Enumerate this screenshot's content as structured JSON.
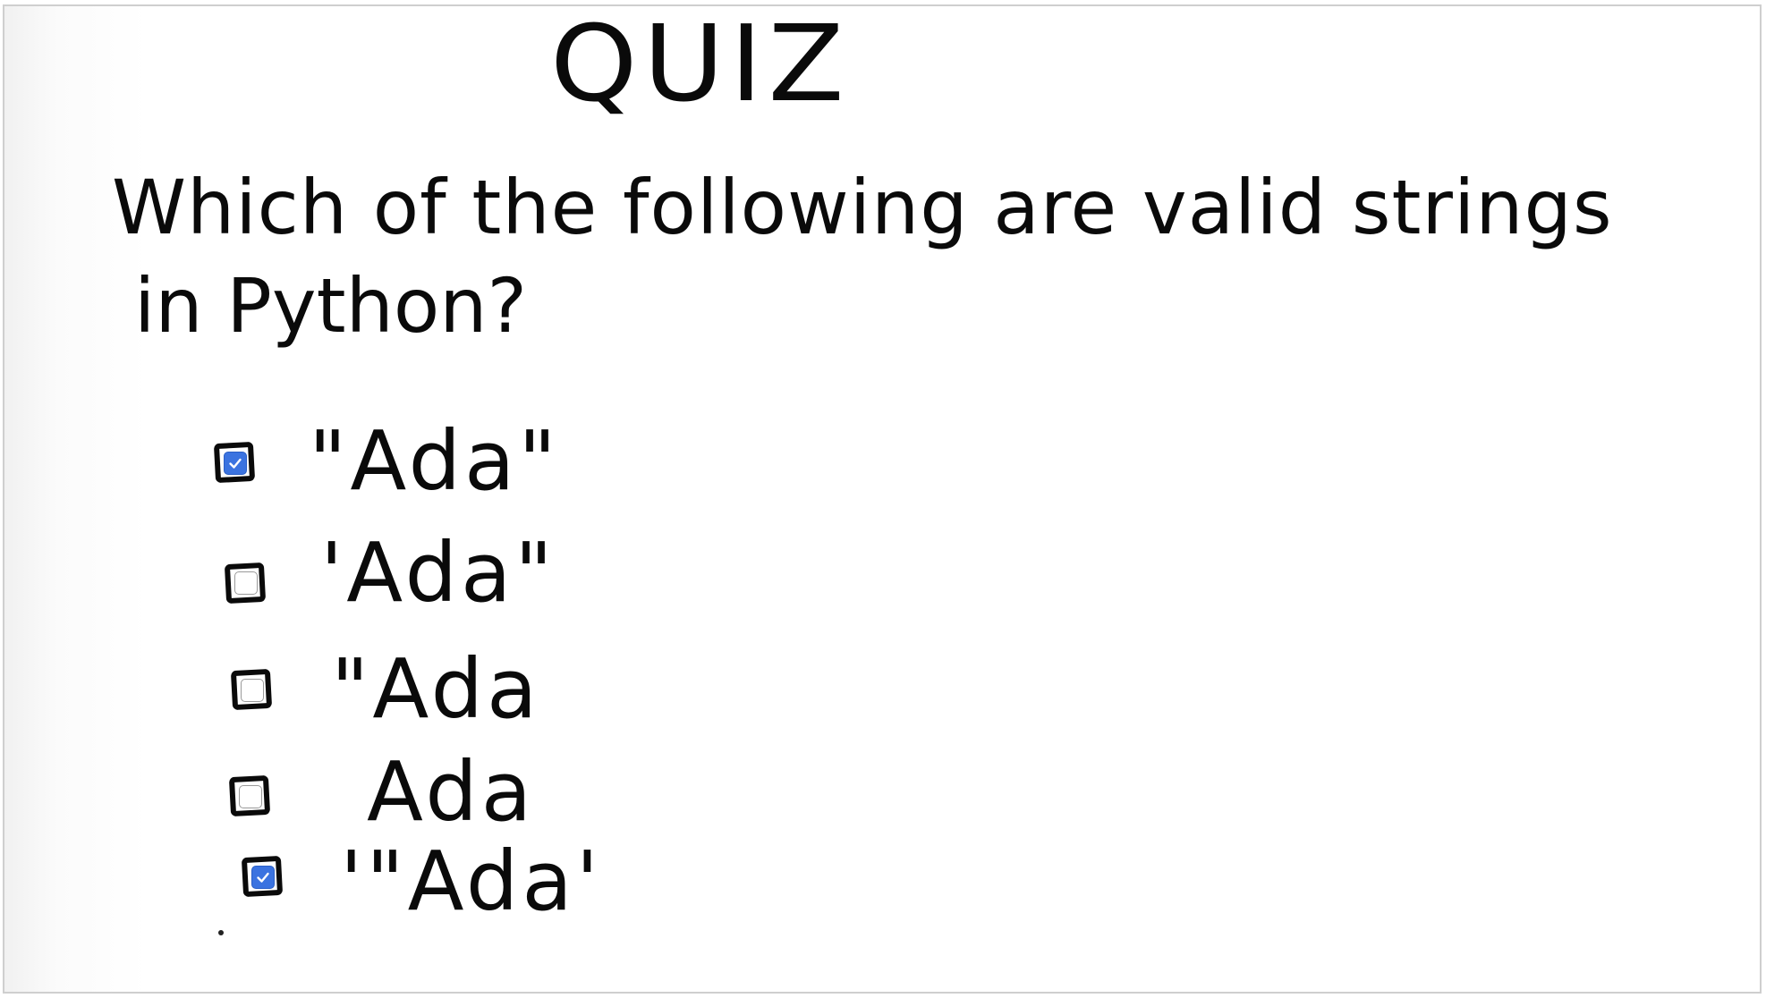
{
  "quiz": {
    "title": "QUIZ",
    "question_line_1": "Which of the following are valid strings",
    "question_line_2": "in Python?",
    "options": [
      {
        "label": "\"Ada\"",
        "checked": true
      },
      {
        "label": "'Ada\"",
        "checked": false
      },
      {
        "label": "\"Ada",
        "checked": false
      },
      {
        "label": "Ada",
        "checked": false
      },
      {
        "label": "'\"Ada'",
        "checked": true
      }
    ]
  },
  "colors": {
    "ink": "#0a0a0a",
    "checkbox_checked": "#3b73e0",
    "background": "#ffffff"
  },
  "icons": {
    "checkmark": "check-icon",
    "hand_drawn_box": "hand-drawn-box-icon"
  }
}
